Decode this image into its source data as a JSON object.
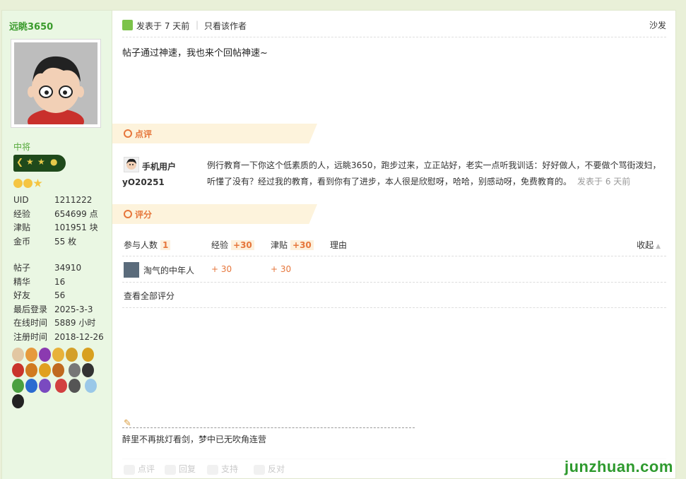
{
  "sidebar": {
    "username": "远眺3650",
    "rank": "中将",
    "stats": [
      {
        "k": "UID",
        "v": "1211222"
      },
      {
        "k": "经验",
        "v": "654699 点"
      },
      {
        "k": "津贴",
        "v": "101951 块"
      },
      {
        "k": "金币",
        "v": "55 枚"
      }
    ],
    "stats2": [
      {
        "k": "帖子",
        "v": "34910"
      },
      {
        "k": "精华",
        "v": "16"
      },
      {
        "k": "好友",
        "v": "56"
      },
      {
        "k": "最后登录",
        "v": "2025-3-3"
      },
      {
        "k": "在线时间",
        "v": "5889 小时"
      },
      {
        "k": "注册时间",
        "v": "2018-12-26"
      }
    ]
  },
  "post": {
    "posted": "发表于 7 天前",
    "only_author": "只看该作者",
    "floor": "沙发",
    "content": "帖子通过神速，我也来个回帖神速~"
  },
  "comment": {
    "section": "点评",
    "user_line1": "手机用户",
    "user_line2": "yO20251",
    "text": "例行教育一下你这个低素质的人，远眺3650，跑步过来，立正站好，老实一点听我训话：好好做人，不要做个骂街泼妇，听懂了没有？经过我的教育，看到你有了进步，本人很是欣慰呀，哈哈，别感动呀，免费教育的。",
    "time": "发表于 6 天前"
  },
  "rating": {
    "section": "评分",
    "participants_label": "参与人数",
    "participants": "1",
    "exp_label": "经验",
    "exp_total": "+30",
    "coin_label": "津贴",
    "coin_total": "+30",
    "reason_label": "理由",
    "collapse": "收起",
    "rows": [
      {
        "user": "淘气的中年人",
        "exp": "+ 30",
        "coin": "+ 30"
      }
    ],
    "view_all": "查看全部评分"
  },
  "signature": "醉里不再挑灯看剑，梦中已无吹角连营",
  "actions": [
    "点评",
    "回复",
    "支持",
    "反对"
  ],
  "watermark": "junzhuan.com",
  "colors": {
    "accent": "#e6763b",
    "username": "#3a9b2c",
    "sidebar_bg": "#eaf7e3"
  }
}
